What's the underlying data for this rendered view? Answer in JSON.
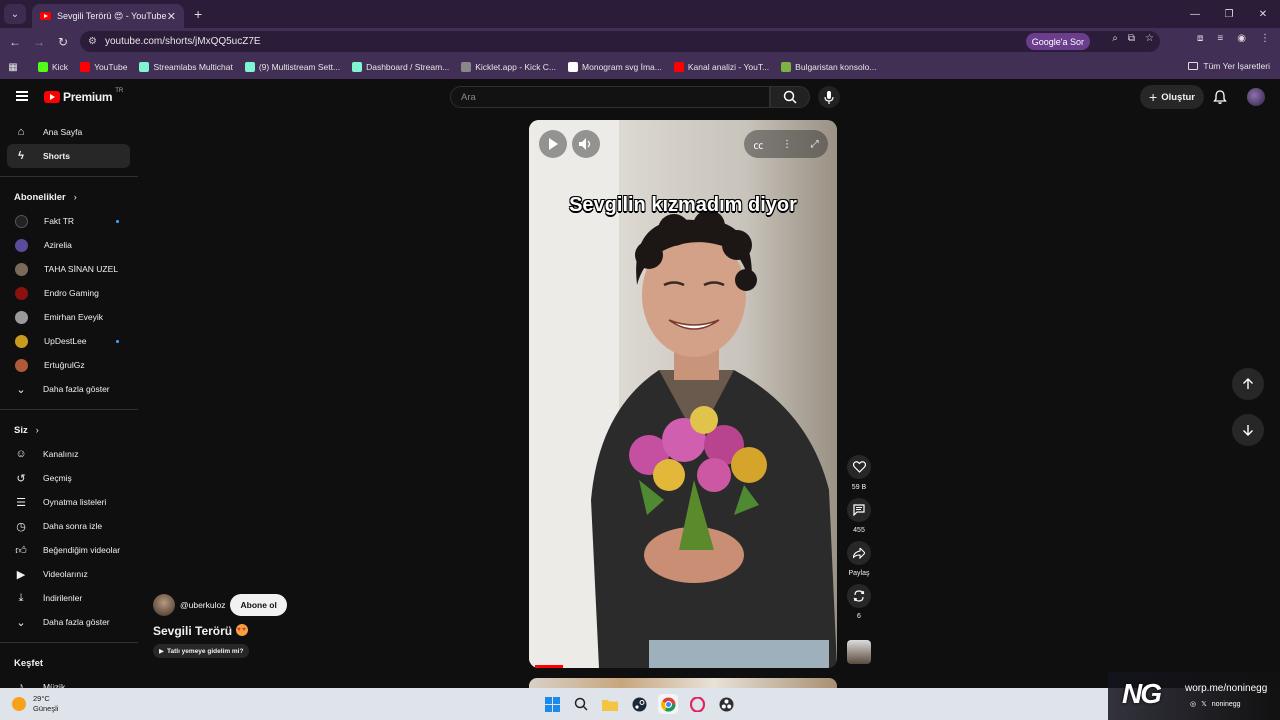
{
  "browser": {
    "tab_title": "Sevgili Terörü 😍 - YouTube",
    "url": "youtube.com/shorts/jMxQQ5ucZ7E",
    "google_ask": "Google'a Sor",
    "bookmarks": [
      {
        "label": "Kick",
        "color": "#53fc18"
      },
      {
        "label": "YouTube",
        "color": "#ff0000"
      },
      {
        "label": "Streamlabs Multichat",
        "color": "#80f5d2"
      },
      {
        "label": "(9) Multistream Sett...",
        "color": "#80f5d2"
      },
      {
        "label": "Dashboard / Stream...",
        "color": "#80f5d2"
      },
      {
        "label": "Kicklet.app - Kick C...",
        "color": "#888888"
      },
      {
        "label": "Monogram svg İma...",
        "color": "#ffffff"
      },
      {
        "label": "Kanal analizi - YouT...",
        "color": "#ff0000"
      },
      {
        "label": "Bulgaristan konsolo...",
        "color": "#7cb342"
      }
    ],
    "all_bookmarks": "Tüm Yer İşaretleri"
  },
  "masthead": {
    "logo_word": "Premium",
    "region": "TR",
    "search_placeholder": "Ara",
    "create_label": "Oluştur"
  },
  "sidebar": {
    "main": [
      {
        "label": "Ana Sayfa",
        "icon": "home-icon"
      },
      {
        "label": "Shorts",
        "icon": "shorts-icon"
      }
    ],
    "subscriptions_title": "Abonelikler",
    "subscriptions": [
      {
        "label": "Fakt TR",
        "color": "#222222",
        "live": true
      },
      {
        "label": "Azirelia",
        "color": "#5b4b9a",
        "live": false
      },
      {
        "label": "TAHA SİNAN UZEL",
        "color": "#7a6a5a",
        "live": false
      },
      {
        "label": "Endro Gaming",
        "color": "#8b1010",
        "live": false
      },
      {
        "label": "Emirhan Eveyik",
        "color": "#9a9a9a",
        "live": false
      },
      {
        "label": "UpDestLee",
        "color": "#c89a20",
        "live": true
      },
      {
        "label": "ErtuğrulGz",
        "color": "#b05a3a",
        "live": false
      }
    ],
    "show_more": "Daha fazla göster",
    "you_title": "Siz",
    "you": [
      {
        "label": "Kanalınız",
        "icon": "channel-icon"
      },
      {
        "label": "Geçmiş",
        "icon": "history-icon"
      },
      {
        "label": "Oynatma listeleri",
        "icon": "playlist-icon"
      },
      {
        "label": "Daha sonra izle",
        "icon": "clock-icon"
      },
      {
        "label": "Beğendiğim videolar",
        "icon": "like-icon"
      },
      {
        "label": "Videolarınız",
        "icon": "video-icon"
      },
      {
        "label": "İndirilenler",
        "icon": "download-icon"
      },
      {
        "label": "Daha fazla göster",
        "icon": "chevron-down-icon"
      }
    ],
    "explore_title": "Keşfet",
    "explore": [
      {
        "label": "Müzik",
        "icon": "music-icon"
      }
    ]
  },
  "short": {
    "caption": "Sevgilin kızmadım diyor",
    "channel": "@uberkuloz",
    "subscribe": "Abone ol",
    "title": "Sevgili Terörü",
    "sound": "Tatlı yemeye gidelim mi?",
    "likes": "59 B",
    "comments": "455",
    "share": "Paylaş",
    "remix": "6"
  },
  "taskbar": {
    "temp": "29°C",
    "weather": "Güneşli"
  },
  "watermark": {
    "logo": "NG",
    "url": "worp.me/noninegg",
    "handle": "noninegg"
  }
}
